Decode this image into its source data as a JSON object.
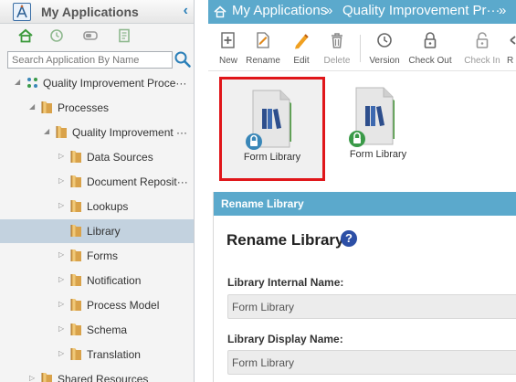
{
  "sidebar": {
    "title": "My Applications",
    "collapse_glyph": "‹",
    "quick_icons": [
      "home-icon",
      "history-icon",
      "toggle-icon",
      "notes-icon"
    ],
    "search": {
      "placeholder": "Search Application By Name",
      "value": ""
    },
    "tree": [
      {
        "label": "Quality Improvement Proce···",
        "selected": false
      },
      {
        "label": "Processes",
        "selected": false
      },
      {
        "label": "Quality Improvement ···",
        "selected": false
      },
      {
        "label": "Data Sources",
        "selected": false
      },
      {
        "label": "Document Reposit···",
        "selected": false
      },
      {
        "label": "Lookups",
        "selected": false
      },
      {
        "label": "Library",
        "selected": true
      },
      {
        "label": "Forms",
        "selected": false
      },
      {
        "label": "Notification",
        "selected": false
      },
      {
        "label": "Process Model",
        "selected": false
      },
      {
        "label": "Schema",
        "selected": false
      },
      {
        "label": "Translation",
        "selected": false
      },
      {
        "label": "Shared Resources",
        "selected": false
      }
    ]
  },
  "breadcrumb": {
    "items": [
      "My Applications",
      "Quality Improvement Pr···"
    ],
    "separator": "»"
  },
  "toolbar": {
    "buttons": [
      {
        "label": "New",
        "icon": "new-icon",
        "enabled": true
      },
      {
        "label": "Rename",
        "icon": "rename-icon",
        "enabled": true
      },
      {
        "label": "Edit",
        "icon": "edit-icon",
        "enabled": true
      },
      {
        "label": "Delete",
        "icon": "delete-icon",
        "enabled": false
      },
      {
        "label": "Version",
        "icon": "version-icon",
        "enabled": true
      },
      {
        "label": "Check Out",
        "icon": "check-out-icon",
        "enabled": true
      },
      {
        "label": "Check In",
        "icon": "check-in-icon",
        "enabled": false
      },
      {
        "label": "R",
        "icon": "revert-icon",
        "enabled": true
      }
    ]
  },
  "libraries": [
    {
      "label": "Form Library",
      "selected": true,
      "lock_color": "#3a87b8"
    },
    {
      "label": "Form Library",
      "selected": false,
      "lock_color": "#3a9a48"
    }
  ],
  "rename_panel": {
    "header": "Rename Library",
    "title": "Rename Library",
    "help_glyph": "?",
    "internal_name_label": "Library Internal Name:",
    "internal_name_value": "Form Library",
    "display_name_label": "Library Display Name:",
    "display_name_value": "Form Library"
  },
  "colors": {
    "accent": "#5ba9cc",
    "selection": "#c3d2df",
    "highlight_border": "#e0161a",
    "folder": "#d9a24a"
  }
}
